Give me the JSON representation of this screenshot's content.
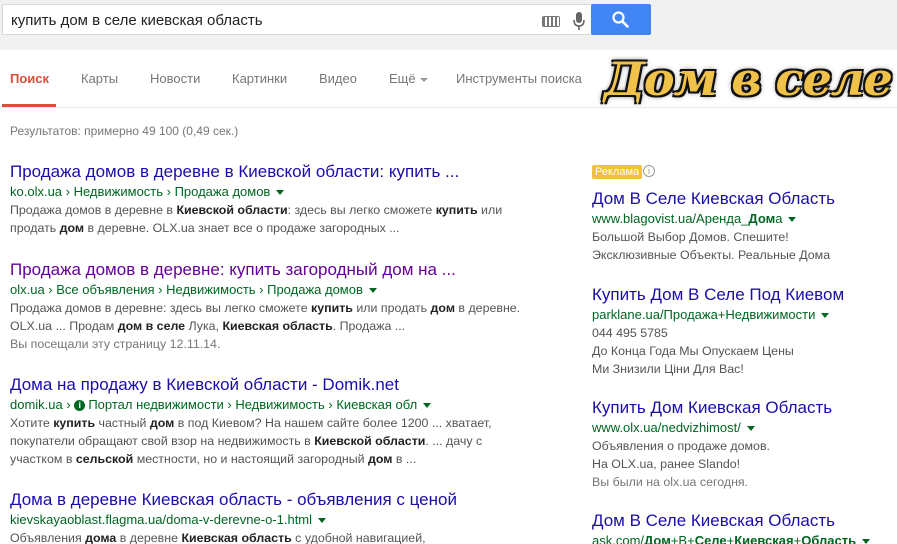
{
  "search": {
    "query": "купить дом в селе киевская область"
  },
  "tabs": [
    {
      "label": "Поиск"
    },
    {
      "label": "Карты"
    },
    {
      "label": "Новости"
    },
    {
      "label": "Картинки"
    },
    {
      "label": "Видео"
    },
    {
      "label": "Ещё"
    },
    {
      "label": "Инструменты поиска"
    }
  ],
  "overlay_title": "Дом в селе",
  "stats": "Результатов: примерно 49 100 (0,49 сек.)",
  "results": [
    {
      "title": "Продажа домов в деревне в Киевской области: купить ...",
      "url": "ko.olx.ua › Недвижимость › Продажа домов",
      "snippet": [
        [
          "Продажа домов в деревне в ",
          false
        ],
        [
          "Киевской области",
          true
        ],
        [
          ": здесь вы легко сможете ",
          false
        ],
        [
          "купить",
          true
        ],
        [
          " или продать ",
          false
        ],
        [
          "дом",
          true
        ],
        [
          " в деревне. OLX.ua знает все о продаже загородных ...",
          false
        ]
      ]
    },
    {
      "title": "Продажа домов в деревне: купить загородный дом на ...",
      "url": "olx.ua › Все объявления › Недвижимость › Продажа домов",
      "snippet": [
        [
          "Продажа домов в деревне: здесь вы легко сможете ",
          false
        ],
        [
          "купить",
          true
        ],
        [
          " или продать ",
          false
        ],
        [
          "дом",
          true
        ],
        [
          " в деревне. OLX.ua ... Продам ",
          false
        ],
        [
          "дом в селе",
          true
        ],
        [
          " Лука, ",
          false
        ],
        [
          "Киевская область",
          true
        ],
        [
          ". Продажа ...",
          false
        ]
      ],
      "visited": "Вы посещали эту страницу 12.11.14."
    },
    {
      "title": "Дома на продажу в Киевской области - Domik.net",
      "url_pre": "domik.ua › ",
      "url_info": "i",
      "url": "Портал недвижимости › Недвижимость › Киевская обл",
      "snippet": [
        [
          "Хотите ",
          false
        ],
        [
          "купить",
          true
        ],
        [
          " частный ",
          false
        ],
        [
          "дом",
          true
        ],
        [
          " в под Киевом? На нашем сайте более 1200 ... хватает, покупатели обращают свой взор на недвижимость в ",
          false
        ],
        [
          "Киевской области",
          true
        ],
        [
          ". ... дачу с участком в ",
          false
        ],
        [
          "сельской",
          true
        ],
        [
          " местности, но и настоящий загородный ",
          false
        ],
        [
          "дом",
          true
        ],
        [
          " в ...",
          false
        ]
      ]
    },
    {
      "title": "Дома в деревне Киевская область - объявления с ценой",
      "url": "kievskayaoblast.flagma.ua/doma-v-derevne-o-1.html",
      "snippet": [
        [
          "Объявления ",
          false
        ],
        [
          "дома",
          true
        ],
        [
          " в деревне ",
          false
        ],
        [
          "Киевская область",
          true
        ],
        [
          " с удобной навигацией,",
          false
        ]
      ]
    }
  ],
  "ads": {
    "label": "Реклама",
    "info": "i",
    "items": [
      {
        "title": "Дом В Селе Киевская Область",
        "url_parts": [
          [
            "www.blagovist.ua/Аренда_",
            false
          ],
          [
            "Дом",
            true
          ],
          [
            "а",
            false
          ]
        ],
        "lines": [
          "Большой Выбор Домов. Спешите!",
          "Эксклюзивные Объекты. Реальные Дома"
        ]
      },
      {
        "title": "Купить Дом В Селе Под Киевом",
        "url_parts": [
          [
            "parklane.ua/Продажа+Недвижимости",
            false
          ]
        ],
        "lines": [
          "044 495 5785",
          "До Конца Года Мы Опускаем Цены",
          "Ми Знизили Ціни Для Вас!"
        ]
      },
      {
        "title": "Купить Дом Киевская Область",
        "url_parts": [
          [
            "www.olx.ua/nedvizhimost/",
            false
          ]
        ],
        "lines": [
          "Объявления о продаже домов.",
          "На OLX.ua, ранее Slando!"
        ],
        "visited": "Вы были на olx.ua сегодня."
      },
      {
        "title": "Дом В Селе Киевская Область",
        "url_parts": [
          [
            "ask.com/",
            false
          ],
          [
            "Дом",
            true
          ],
          [
            "+В+",
            false
          ],
          [
            "Селе",
            true
          ],
          [
            "+",
            false
          ],
          [
            "Киевская",
            true
          ],
          [
            "+",
            false
          ],
          [
            "Область",
            true
          ]
        ],
        "lines": []
      }
    ]
  },
  "colors": {
    "link": "#1a0dab",
    "visited": "#660099",
    "url": "#006621",
    "active_tab": "#dd4b39",
    "search_button": "#4285f4",
    "ad_badge": "#f0c23a"
  },
  "icons": [
    "keyboard-icon",
    "microphone-icon",
    "search-icon",
    "chevron-down-icon",
    "info-icon"
  ]
}
